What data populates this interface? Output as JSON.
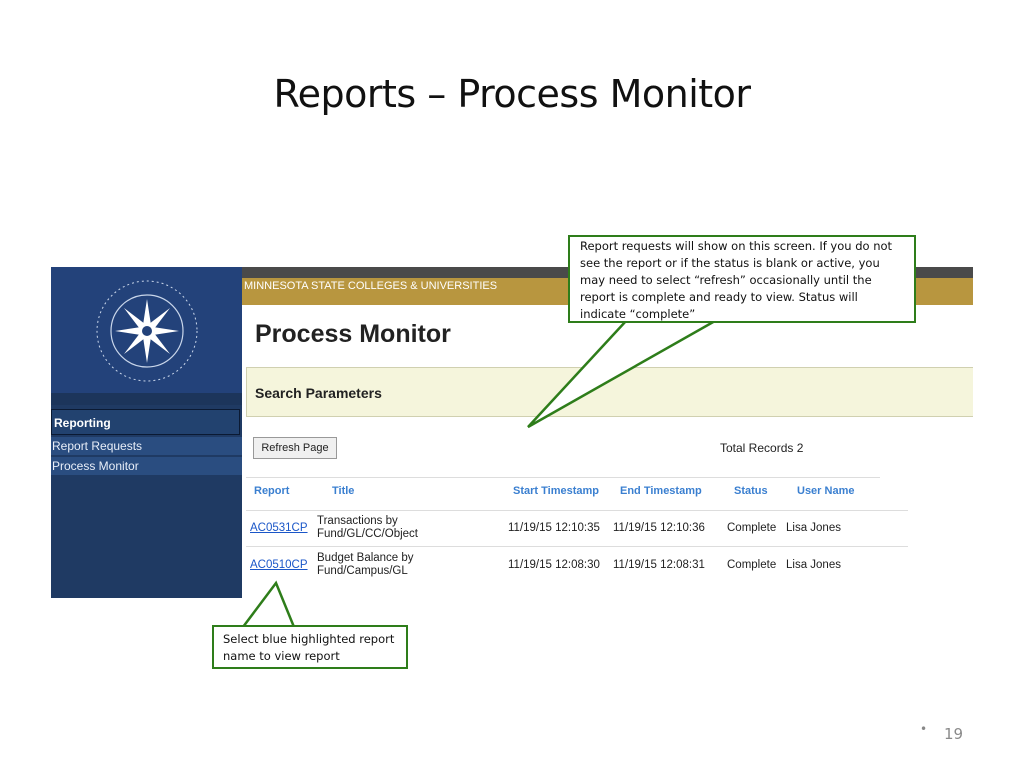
{
  "slide": {
    "title": "Reports – Process Monitor",
    "page_number": "19",
    "bullet": "•"
  },
  "app": {
    "brand": "MINNESOTA STATE COLLEGES & UNIVERSITIES",
    "page_title": "Process Monitor",
    "search_section": "Search Parameters",
    "refresh_label": "Refresh Page",
    "total_records": "Total Records 2",
    "logo_icon": "msu-seal-icon"
  },
  "nav": {
    "header": "Reporting",
    "items": [
      "Report Requests",
      "Process Monitor"
    ]
  },
  "table": {
    "columns": [
      "Report",
      "Title",
      "Start Timestamp",
      "End Timestamp",
      "Status",
      "User Name"
    ],
    "rows": [
      {
        "report": "AC0531CP",
        "title_line1": "Transactions by",
        "title_line2": "Fund/GL/CC/Object",
        "start": "11/19/15 12:10:35",
        "end": "11/19/15 12:10:36",
        "status": "Complete",
        "user": "Lisa Jones"
      },
      {
        "report": "AC0510CP",
        "title_line1": "Budget Balance by",
        "title_line2": "Fund/Campus/GL",
        "start": "11/19/15 12:08:30",
        "end": "11/19/15 12:08:31",
        "status": "Complete",
        "user": "Lisa Jones"
      }
    ]
  },
  "callouts": {
    "top": "Report requests will show on this screen.  If you do not see the report or if the status is blank or active, you may need to select “refresh” occasionally until the report is complete and ready to view.  Status will indicate “complete”",
    "bottom": "Select blue highlighted report name to view report"
  },
  "colors": {
    "accent_green": "#2e7d1a",
    "nav_blue": "#1f3a63",
    "brand_gold": "#b8963f",
    "link_blue": "#1a56c8"
  }
}
